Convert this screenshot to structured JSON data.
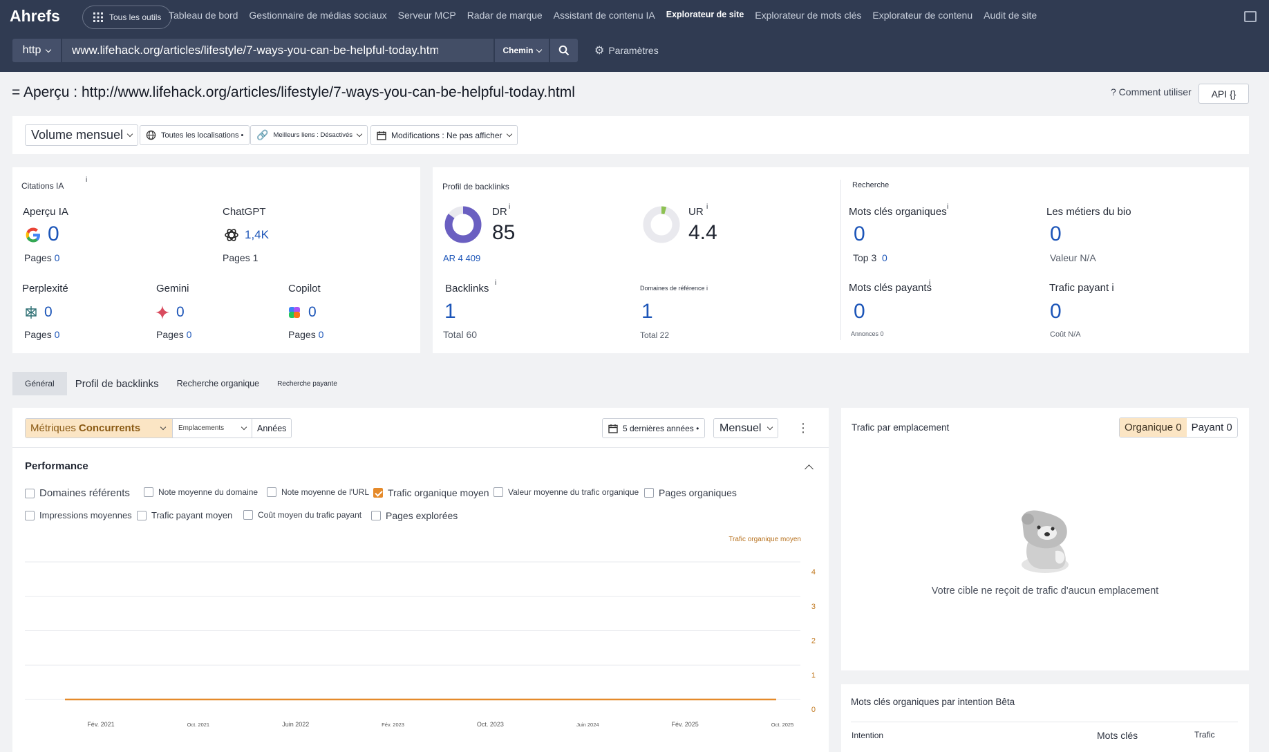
{
  "app": {
    "logo": "Ahrefs",
    "all_tools": "Tous les outils",
    "nav": [
      "Tableau de bord",
      "Gestionnaire de médias sociaux",
      "Serveur MCP",
      "Radar de marque",
      "Assistant de contenu IA",
      "Explorateur de site",
      "Explorateur de mots clés",
      "Explorateur de contenu",
      "Audit de site"
    ],
    "nav_active_index": 5
  },
  "urlbar": {
    "protocol": "http",
    "url": "www.lifehack.org/articles/lifestyle/7-ways-you-can-be-helpful-today.html",
    "mode": "Chemin",
    "settings": "Paramètres"
  },
  "header": {
    "title": "= Aperçu : http://www.lifehack.org/articles/lifestyle/7-ways-you-can-be-helpful-today.html",
    "how_to": "? Comment utiliser",
    "api": "API {}"
  },
  "filters": {
    "volume": "Volume mensuel",
    "locations": "Toutes les localisations •",
    "best_links": "Meilleurs liens : Désactivés",
    "changes": "Modifications : Ne pas afficher"
  },
  "ai_citations": {
    "title": "Citations IA",
    "info": "i",
    "items": [
      {
        "name": "Aperçu IA",
        "value": "0",
        "pages_label": "Pages",
        "pages": "0"
      },
      {
        "name": "ChatGPT",
        "value": "1,4K",
        "pages_label": "Pages",
        "pages": "1"
      },
      {
        "name": "Perplexité",
        "value": "0",
        "pages_label": "Pages",
        "pages": "0"
      },
      {
        "name": "Gemini",
        "value": "0",
        "pages_label": "Pages",
        "pages": "0"
      },
      {
        "name": "Copilot",
        "value": "0",
        "pages_label": "Pages",
        "pages": "0"
      }
    ]
  },
  "backlinks": {
    "title": "Profil de backlinks",
    "dr_label": "DR",
    "dr_value": "85",
    "dr_fraction": 0.85,
    "ar": "AR 4 409",
    "ur_label": "UR",
    "ur_value": "4.4",
    "ur_fraction": 0.044,
    "backlinks_label": "Backlinks",
    "backlinks_value": "1",
    "backlinks_total": "Total 60",
    "refdomains_label": "Domaines de référence i",
    "refdomains_value": "1",
    "refdomains_total": "Total 22",
    "info": "i"
  },
  "search": {
    "title": "Recherche",
    "organic_kw_label": "Mots clés organiques",
    "organic_kw_value": "0",
    "top3_label": "Top 3",
    "top3_value": "0",
    "bio_label": "Les métiers du bio",
    "bio_value": "0",
    "bio_sub": "Valeur N/A",
    "paid_kw_label": "Mots clés payants",
    "paid_kw_value": "0",
    "ads": "Annonces 0",
    "paid_traffic_label": "Trafic payant i",
    "paid_traffic_value": "0",
    "cost": "Coût N/A",
    "info": "i"
  },
  "tabs": [
    "Général",
    "Profil de backlinks",
    "Recherche organique",
    "Recherche payante"
  ],
  "chart_panel": {
    "metric_prefix": "Métriques",
    "metric_select": "Concurrents",
    "locations": "Emplacements",
    "years": "Années",
    "period": "5 dernières années •",
    "interval": "Mensuel",
    "section_title": "Performance",
    "checkboxes": [
      {
        "label": "Domaines référents",
        "checked": false
      },
      {
        "label": "Note moyenne du domaine",
        "checked": false
      },
      {
        "label": "Note moyenne de l'URL",
        "checked": false
      },
      {
        "label": "Trafic organique moyen",
        "checked": true
      },
      {
        "label": "Valeur moyenne du trafic organique",
        "checked": false
      },
      {
        "label": "Pages organiques",
        "checked": false
      },
      {
        "label": "Impressions moyennes",
        "checked": false
      },
      {
        "label": "Trafic payant moyen",
        "checked": false
      },
      {
        "label": "Coût moyen du trafic payant",
        "checked": false
      },
      {
        "label": "Pages explorées",
        "checked": false
      }
    ],
    "series_color": "#e58a2a"
  },
  "chart_data": {
    "type": "line",
    "title": "",
    "xlabel": "",
    "ylabel": "Trafic organique moyen",
    "x_ticks": [
      "Fév. 2021",
      "Oct. 2021",
      "Juin 2022",
      "Fév. 2023",
      "Oct. 2023",
      "Juin 2024",
      "Fév. 2025",
      "Oct. 2025"
    ],
    "y_ticks": [
      0,
      1,
      2,
      3,
      4
    ],
    "ylim": [
      0,
      4
    ],
    "series": [
      {
        "name": "Trafic organique moyen",
        "x": [
          "Fév. 2021",
          "Oct. 2025"
        ],
        "values": [
          0,
          0
        ]
      }
    ],
    "grid": true
  },
  "location_panel": {
    "title": "Trafic par emplacement",
    "organic": "Organique 0",
    "paid": "Payant 0",
    "empty_message": "Votre cible ne reçoit de trafic d'aucun emplacement"
  },
  "intent_panel": {
    "title": "Mots clés organiques par intention Bêta",
    "col_intent": "Intention",
    "col_keywords": "Mots clés",
    "col_traffic": "Trafic"
  }
}
